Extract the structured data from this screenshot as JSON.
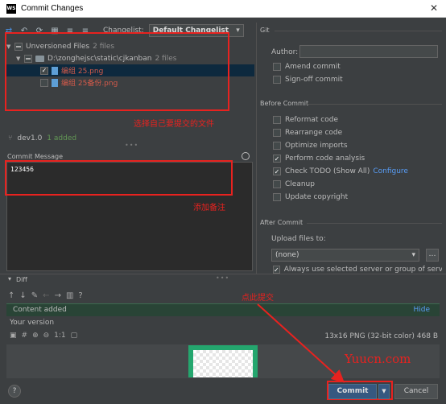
{
  "window": {
    "title": "Commit Changes",
    "app_icon": "WS"
  },
  "toolbar": {
    "changelist_label": "Changelist:",
    "changelist_value": "Default Changelist"
  },
  "tree": {
    "group_label": "Unversioned Files",
    "group_count": "2 files",
    "folder_path": "D:\\zonghejsc\\static\\cjkanban",
    "folder_count": "2 files",
    "files": [
      "编组 25.png",
      "编组 25备份.png"
    ]
  },
  "status": {
    "branch": "dev1.0",
    "added": "1 added"
  },
  "commit_message": {
    "label": "Commit Message",
    "text": "123456"
  },
  "annotations": {
    "select_files": "选择自己要提交的文件",
    "add_note": "添加备注",
    "click_commit": "点此提交"
  },
  "git": {
    "section": "Git",
    "author_label": "Author:",
    "amend": "Amend commit",
    "signoff": "Sign-off commit"
  },
  "before_commit": {
    "section": "Before Commit",
    "options": [
      "Reformat code",
      "Rearrange code",
      "Optimize imports",
      "Perform code analysis",
      "Check TODO (Show All)",
      "Cleanup",
      "Update copyright"
    ],
    "checked": [
      false,
      false,
      false,
      true,
      true,
      false,
      false
    ],
    "configure_link": "Configure"
  },
  "after_commit": {
    "section": "After Commit",
    "upload_label": "Upload files to:",
    "upload_value": "(none)",
    "always_use": "Always use selected server or group of servers"
  },
  "diff": {
    "label": "Diff",
    "content_added": "Content added",
    "hide": "Hide",
    "your_version": "Your version",
    "image_info": "13x16 PNG (32-bit color) 468 B",
    "zoom_label": "1:1"
  },
  "watermark": "Yuucn.com",
  "buttons": {
    "commit": "Commit",
    "cancel": "Cancel",
    "help": "?"
  }
}
